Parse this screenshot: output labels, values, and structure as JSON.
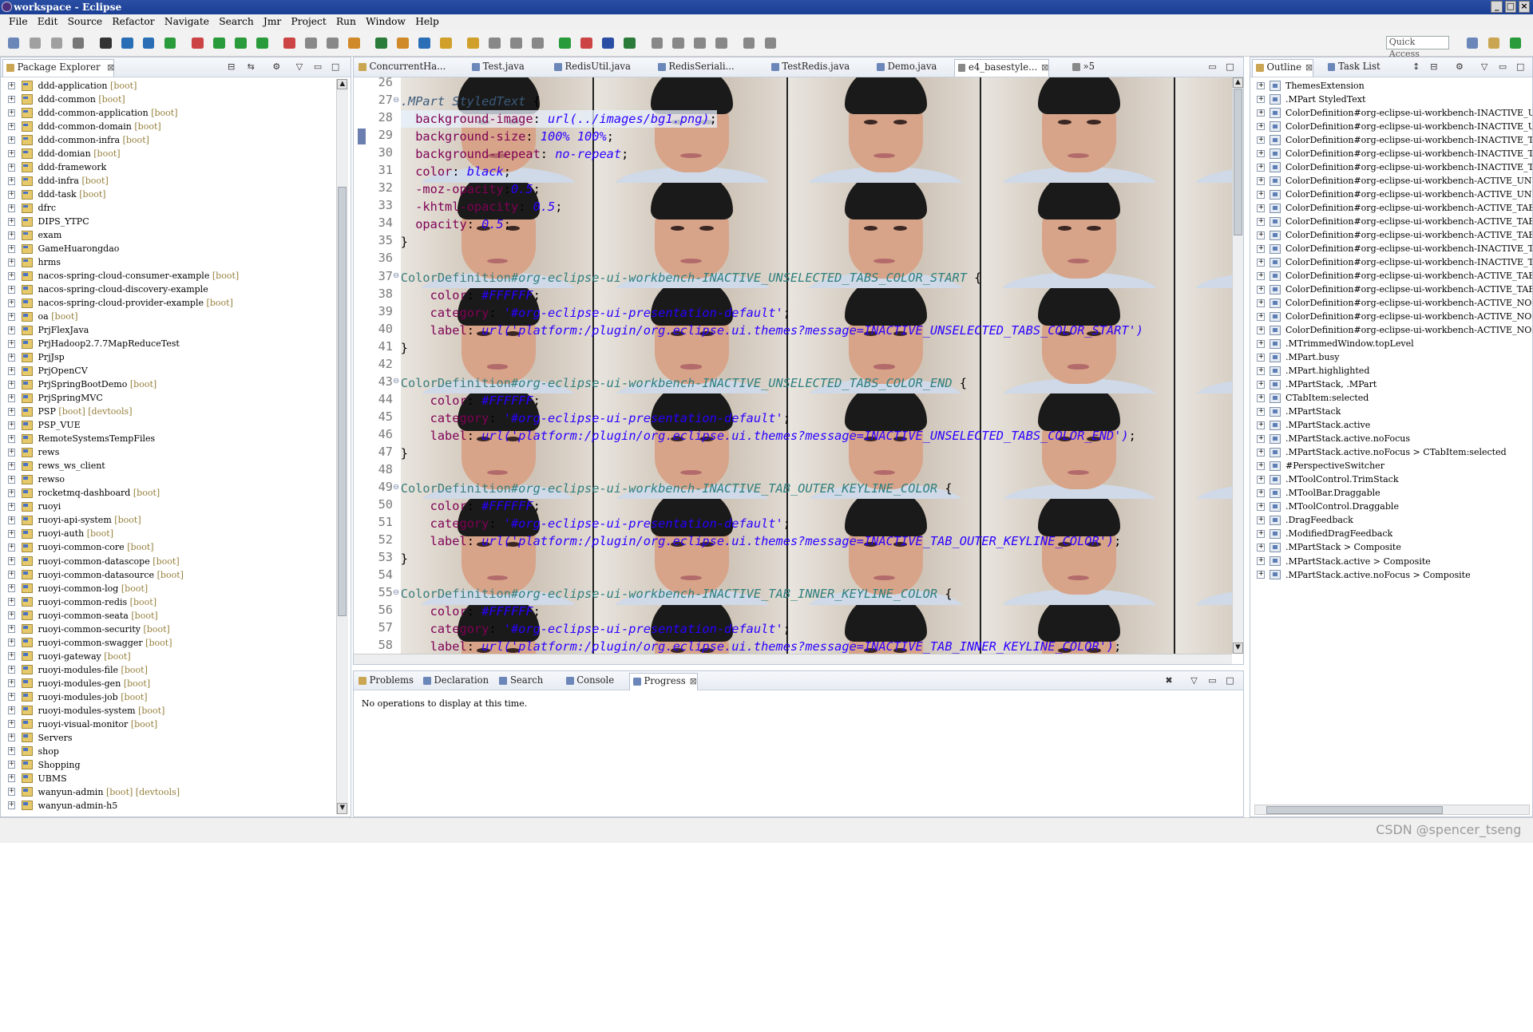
{
  "window": {
    "title": "workspace - Eclipse"
  },
  "menu": [
    "File",
    "Edit",
    "Source",
    "Refactor",
    "Navigate",
    "Search",
    "Jmr",
    "Project",
    "Run",
    "Window",
    "Help"
  ],
  "toolbar": {
    "quick_access_placeholder": "Quick Access"
  },
  "package_explorer": {
    "tab_label": "Package Explorer",
    "projects": [
      {
        "name": "ddd-application",
        "tag": "[boot]"
      },
      {
        "name": "ddd-common",
        "tag": "[boot]"
      },
      {
        "name": "ddd-common-application",
        "tag": "[boot]"
      },
      {
        "name": "ddd-common-domain",
        "tag": "[boot]"
      },
      {
        "name": "ddd-common-infra",
        "tag": "[boot]"
      },
      {
        "name": "ddd-domian",
        "tag": "[boot]"
      },
      {
        "name": "ddd-framework",
        "tag": ""
      },
      {
        "name": "ddd-infra",
        "tag": "[boot]"
      },
      {
        "name": "ddd-task",
        "tag": "[boot]"
      },
      {
        "name": "dfrc",
        "tag": ""
      },
      {
        "name": "DIPS_YTPC",
        "tag": ""
      },
      {
        "name": "exam",
        "tag": ""
      },
      {
        "name": "GameHuarongdao",
        "tag": ""
      },
      {
        "name": "hrms",
        "tag": ""
      },
      {
        "name": "nacos-spring-cloud-consumer-example",
        "tag": "[boot]"
      },
      {
        "name": "nacos-spring-cloud-discovery-example",
        "tag": ""
      },
      {
        "name": "nacos-spring-cloud-provider-example",
        "tag": "[boot]"
      },
      {
        "name": "oa",
        "tag": "[boot]"
      },
      {
        "name": "PrjFlexJava",
        "tag": ""
      },
      {
        "name": "PrjHadoop2.7.7MapReduceTest",
        "tag": ""
      },
      {
        "name": "PrjJsp",
        "tag": ""
      },
      {
        "name": "PrjOpenCV",
        "tag": ""
      },
      {
        "name": "PrjSpringBootDemo",
        "tag": "[boot]"
      },
      {
        "name": "PrjSpringMVC",
        "tag": ""
      },
      {
        "name": "PSP",
        "tag": "[boot] [devtools]"
      },
      {
        "name": "PSP_VUE",
        "tag": ""
      },
      {
        "name": "RemoteSystemsTempFiles",
        "tag": ""
      },
      {
        "name": "rews",
        "tag": ""
      },
      {
        "name": "rews_ws_client",
        "tag": ""
      },
      {
        "name": "rewso",
        "tag": ""
      },
      {
        "name": "rocketmq-dashboard",
        "tag": "[boot]"
      },
      {
        "name": "ruoyi",
        "tag": ""
      },
      {
        "name": "ruoyi-api-system",
        "tag": "[boot]"
      },
      {
        "name": "ruoyi-auth",
        "tag": "[boot]"
      },
      {
        "name": "ruoyi-common-core",
        "tag": "[boot]"
      },
      {
        "name": "ruoyi-common-datascope",
        "tag": "[boot]"
      },
      {
        "name": "ruoyi-common-datasource",
        "tag": "[boot]"
      },
      {
        "name": "ruoyi-common-log",
        "tag": "[boot]"
      },
      {
        "name": "ruoyi-common-redis",
        "tag": "[boot]"
      },
      {
        "name": "ruoyi-common-seata",
        "tag": "[boot]"
      },
      {
        "name": "ruoyi-common-security",
        "tag": "[boot]"
      },
      {
        "name": "ruoyi-common-swagger",
        "tag": "[boot]"
      },
      {
        "name": "ruoyi-gateway",
        "tag": "[boot]"
      },
      {
        "name": "ruoyi-modules-file",
        "tag": "[boot]"
      },
      {
        "name": "ruoyi-modules-gen",
        "tag": "[boot]"
      },
      {
        "name": "ruoyi-modules-job",
        "tag": "[boot]"
      },
      {
        "name": "ruoyi-modules-system",
        "tag": "[boot]"
      },
      {
        "name": "ruoyi-visual-monitor",
        "tag": "[boot]"
      },
      {
        "name": "Servers",
        "tag": ""
      },
      {
        "name": "shop",
        "tag": ""
      },
      {
        "name": "Shopping",
        "tag": ""
      },
      {
        "name": "UBMS",
        "tag": ""
      },
      {
        "name": "wanyun-admin",
        "tag": "[boot] [devtools]"
      },
      {
        "name": "wanyun-admin-h5",
        "tag": ""
      }
    ]
  },
  "editor": {
    "tabs": [
      "ConcurrentHa...",
      "Test.java",
      "RedisUtil.java",
      "RedisSeriali...",
      "TestRedis.java",
      "Demo.java",
      "e4_basestyle...",
      "»5"
    ],
    "active_tab": "e4_basestyle...",
    "lines": [
      {
        "n": "26",
        "text": ""
      },
      {
        "n": "27",
        "text": ".MPart StyledText {"
      },
      {
        "n": "28",
        "text": "  background-image: url(../images/bg1.png);"
      },
      {
        "n": "29",
        "text": "  background-size: 100% 100%;"
      },
      {
        "n": "30",
        "text": "  background-repeat: no-repeat;"
      },
      {
        "n": "31",
        "text": "  color: black;"
      },
      {
        "n": "32",
        "text": "  -moz-opacity:0.5;"
      },
      {
        "n": "33",
        "text": "  -khtml-opacity: 0.5;"
      },
      {
        "n": "34",
        "text": "  opacity: 0.5;"
      },
      {
        "n": "35",
        "text": "}"
      },
      {
        "n": "36",
        "text": ""
      },
      {
        "n": "37",
        "text": "ColorDefinition#org-eclipse-ui-workbench-INACTIVE_UNSELECTED_TABS_COLOR_START {"
      },
      {
        "n": "38",
        "text": "    color: #FFFFFF;"
      },
      {
        "n": "39",
        "text": "    category: '#org-eclipse-ui-presentation-default';"
      },
      {
        "n": "40",
        "text": "    label: url('platform:/plugin/org.eclipse.ui.themes?message=INACTIVE_UNSELECTED_TABS_COLOR_START')"
      },
      {
        "n": "41",
        "text": "}"
      },
      {
        "n": "42",
        "text": ""
      },
      {
        "n": "43",
        "text": "ColorDefinition#org-eclipse-ui-workbench-INACTIVE_UNSELECTED_TABS_COLOR_END {"
      },
      {
        "n": "44",
        "text": "    color: #FFFFFF;"
      },
      {
        "n": "45",
        "text": "    category: '#org-eclipse-ui-presentation-default';"
      },
      {
        "n": "46",
        "text": "    label: url('platform:/plugin/org.eclipse.ui.themes?message=INACTIVE_UNSELECTED_TABS_COLOR_END');"
      },
      {
        "n": "47",
        "text": "}"
      },
      {
        "n": "48",
        "text": ""
      },
      {
        "n": "49",
        "text": "ColorDefinition#org-eclipse-ui-workbench-INACTIVE_TAB_OUTER_KEYLINE_COLOR {"
      },
      {
        "n": "50",
        "text": "    color: #FFFFFF;"
      },
      {
        "n": "51",
        "text": "    category: '#org-eclipse-ui-presentation-default';"
      },
      {
        "n": "52",
        "text": "    label: url('platform:/plugin/org.eclipse.ui.themes?message=INACTIVE_TAB_OUTER_KEYLINE_COLOR');"
      },
      {
        "n": "53",
        "text": "}"
      },
      {
        "n": "54",
        "text": ""
      },
      {
        "n": "55",
        "text": "ColorDefinition#org-eclipse-ui-workbench-INACTIVE_TAB_INNER_KEYLINE_COLOR {"
      },
      {
        "n": "56",
        "text": "    color: #FFFFFF;"
      },
      {
        "n": "57",
        "text": "    category: '#org-eclipse-ui-presentation-default';"
      },
      {
        "n": "58",
        "text": "    label: url('platform:/plugin/org.eclipse.ui.themes?message=INACTIVE_TAB_INNER_KEYLINE_COLOR');"
      }
    ]
  },
  "bottom_panel": {
    "tabs": [
      "Problems",
      "Declaration",
      "Search",
      "Console",
      "Progress"
    ],
    "active_tab": "Progress",
    "message": "No operations to display at this time."
  },
  "outline": {
    "tabs": [
      "Outline",
      "Task List"
    ],
    "items": [
      "ThemesExtension",
      ".MPart StyledText",
      "ColorDefinition#org-eclipse-ui-workbench-INACTIVE_U",
      "ColorDefinition#org-eclipse-ui-workbench-INACTIVE_U",
      "ColorDefinition#org-eclipse-ui-workbench-INACTIVE_T",
      "ColorDefinition#org-eclipse-ui-workbench-INACTIVE_T",
      "ColorDefinition#org-eclipse-ui-workbench-INACTIVE_T",
      "ColorDefinition#org-eclipse-ui-workbench-ACTIVE_UNS",
      "ColorDefinition#org-eclipse-ui-workbench-ACTIVE_UNS",
      "ColorDefinition#org-eclipse-ui-workbench-ACTIVE_TAB",
      "ColorDefinition#org-eclipse-ui-workbench-ACTIVE_TAB",
      "ColorDefinition#org-eclipse-ui-workbench-ACTIVE_TAB",
      "ColorDefinition#org-eclipse-ui-workbench-INACTIVE_T",
      "ColorDefinition#org-eclipse-ui-workbench-INACTIVE_T",
      "ColorDefinition#org-eclipse-ui-workbench-ACTIVE_TAB",
      "ColorDefinition#org-eclipse-ui-workbench-ACTIVE_TAB",
      "ColorDefinition#org-eclipse-ui-workbench-ACTIVE_NOF",
      "ColorDefinition#org-eclipse-ui-workbench-ACTIVE_NOF",
      "ColorDefinition#org-eclipse-ui-workbench-ACTIVE_NOF",
      ".MTrimmedWindow.topLevel",
      ".MPart.busy",
      ".MPart.highlighted",
      ".MPartStack, .MPart",
      "CTabItem:selected",
      ".MPartStack",
      ".MPartStack.active",
      ".MPartStack.active.noFocus",
      ".MPartStack.active.noFocus > CTabItem:selected",
      "#PerspectiveSwitcher",
      ".MToolControl.TrimStack",
      ".MToolBar.Draggable",
      ".MToolControl.Draggable",
      ".DragFeedback",
      ".ModifiedDragFeedback",
      ".MPartStack > Composite",
      ".MPartStack.active > Composite",
      ".MPartStack.active.noFocus > Composite"
    ]
  },
  "watermark": "CSDN @spencer_tseng",
  "colors": {
    "accent": "#1b3f95",
    "keyword": "#7f0055",
    "value": "#2a00ff",
    "selector": "#3b7d7d"
  }
}
